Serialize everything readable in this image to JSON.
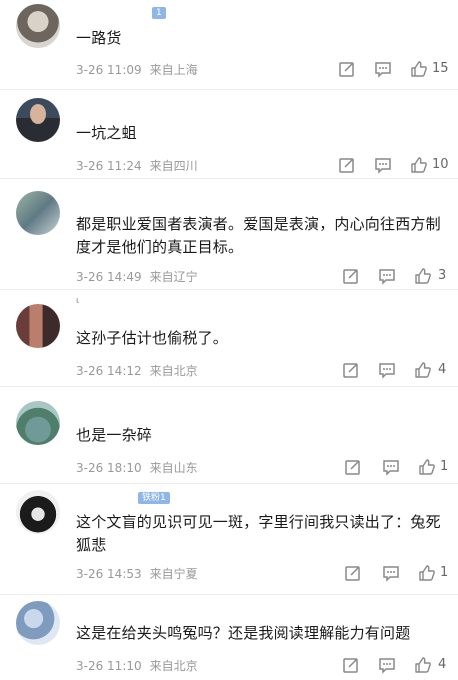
{
  "comments": [
    {
      "text": "一路货",
      "date": "3-26 11:09",
      "location": "来自上海",
      "likes": "15",
      "badge": "1"
    },
    {
      "text": "一坑之蛆",
      "date": "3-26 11:24",
      "location": "来自四川",
      "likes": "10"
    },
    {
      "text": "都是职业爱国者表演者。爱国是表演，内心向往西方制度才是他们的真正目标。",
      "date": "3-26 14:49",
      "location": "来自辽宁",
      "likes": "3"
    },
    {
      "text": "这孙子估计也偷税了。",
      "date": "3-26 14:12",
      "location": "来自北京",
      "likes": "4"
    },
    {
      "text": "也是一杂碎",
      "date": "3-26 18:10",
      "location": "来自山东",
      "likes": "1"
    },
    {
      "text": "这个文盲的见识可见一斑，字里行间我只读出了：兔死狐悲",
      "date": "3-26 14:53",
      "location": "来自宁夏",
      "likes": "1",
      "badge": "铁粉1"
    },
    {
      "text": "这是在给夹头鸣冤吗？还是我阅读理解能力有问题",
      "date": "3-26 11:10",
      "location": "来自北京",
      "likes": "4"
    }
  ],
  "colors": {
    "meta": "#999999",
    "icon": "#888888",
    "badge": "#8fb6e6",
    "divider": "#ececec"
  },
  "icons": {
    "share": "share-icon",
    "comment": "comment-icon",
    "like": "thumbs-up-icon"
  }
}
